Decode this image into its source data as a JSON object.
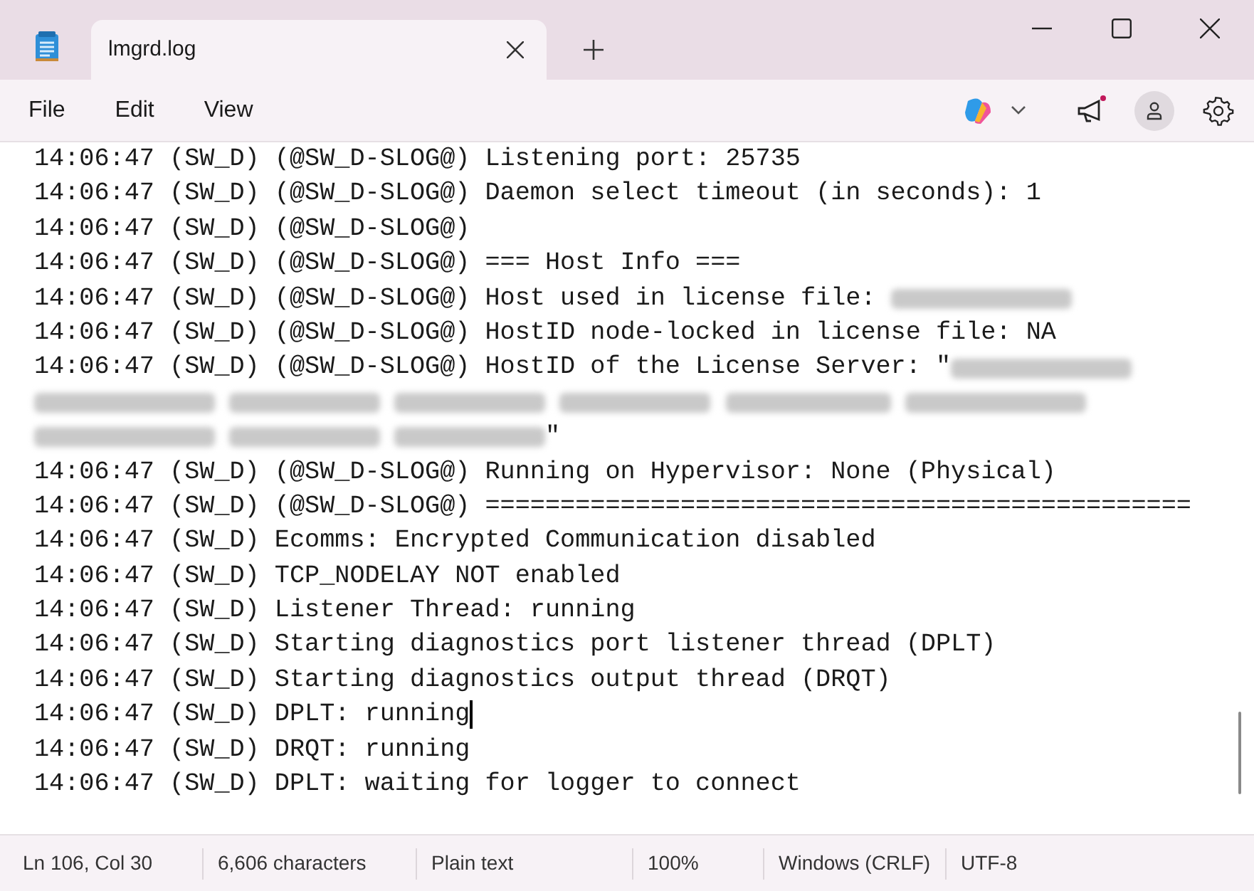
{
  "tabs": [
    {
      "label": "lmgrd.log",
      "selected": true
    }
  ],
  "menu": [
    "File",
    "Edit",
    "View"
  ],
  "lines": [
    {
      "parts": [
        {
          "kind": "text",
          "text": "14:06:47 (SW_D) (@SW_D-SLOG@) Listening port: 25735"
        }
      ]
    },
    {
      "parts": [
        {
          "kind": "text",
          "text": "14:06:47 (SW_D) (@SW_D-SLOG@) Daemon select timeout (in seconds): 1"
        }
      ]
    },
    {
      "parts": [
        {
          "kind": "text",
          "text": "14:06:47 (SW_D) (@SW_D-SLOG@)"
        }
      ]
    },
    {
      "parts": [
        {
          "kind": "text",
          "text": "14:06:47 (SW_D) (@SW_D-SLOG@) === Host Info ==="
        }
      ]
    },
    {
      "parts": [
        {
          "kind": "text",
          "text": "14:06:47 (SW_D) (@SW_D-SLOG@) Host used in license file: "
        },
        {
          "kind": "redacted"
        }
      ]
    },
    {
      "parts": [
        {
          "kind": "text",
          "text": "14:06:47 (SW_D) (@SW_D-SLOG@) HostID node-locked in license file: NA"
        }
      ]
    },
    {
      "parts": [
        {
          "kind": "text",
          "text": "14:06:47 (SW_D) (@SW_D-SLOG@) HostID of the License Server: \""
        },
        {
          "kind": "redacted"
        }
      ]
    },
    {
      "parts": [
        {
          "kind": "redacted"
        },
        {
          "kind": "redacted"
        },
        {
          "kind": "redacted"
        },
        {
          "kind": "redacted"
        },
        {
          "kind": "redacted"
        },
        {
          "kind": "redacted"
        }
      ]
    },
    {
      "parts": [
        {
          "kind": "redacted"
        },
        {
          "kind": "redacted"
        },
        {
          "kind": "redacted"
        },
        {
          "kind": "text",
          "text": "\""
        }
      ]
    },
    {
      "parts": [
        {
          "kind": "text",
          "text": "14:06:47 (SW_D) (@SW_D-SLOG@) Running on Hypervisor: None (Physical)"
        }
      ]
    },
    {
      "parts": [
        {
          "kind": "text",
          "text": "14:06:47 (SW_D) (@SW_D-SLOG@) ==============================================="
        }
      ]
    },
    {
      "parts": [
        {
          "kind": "text",
          "text": "14:06:47 (SW_D) Ecomms: Encrypted Communication disabled"
        }
      ]
    },
    {
      "parts": [
        {
          "kind": "text",
          "text": "14:06:47 (SW_D) TCP_NODELAY NOT enabled"
        }
      ]
    },
    {
      "parts": [
        {
          "kind": "text",
          "text": "14:06:47 (SW_D) Listener Thread: running"
        }
      ]
    },
    {
      "parts": [
        {
          "kind": "text",
          "text": "14:06:47 (SW_D) Starting diagnostics port listener thread (DPLT)"
        }
      ]
    },
    {
      "parts": [
        {
          "kind": "text",
          "text": "14:06:47 (SW_D) Starting diagnostics output thread (DRQT)"
        }
      ]
    },
    {
      "parts": [
        {
          "kind": "text",
          "text": "14:06:47 (SW_D) DPLT: running"
        }
      ],
      "cursor": true
    },
    {
      "parts": [
        {
          "kind": "text",
          "text": "14:06:47 (SW_D) DRQT: running"
        }
      ]
    },
    {
      "parts": [
        {
          "kind": "text",
          "text": "14:06:47 (SW_D) DPLT: waiting for logger to connect"
        }
      ]
    }
  ],
  "status_bar": [
    "Ln 106, Col 30",
    "6,606 characters",
    "Plain text",
    "100%",
    "Windows (CRLF)",
    "UTF-8"
  ]
}
